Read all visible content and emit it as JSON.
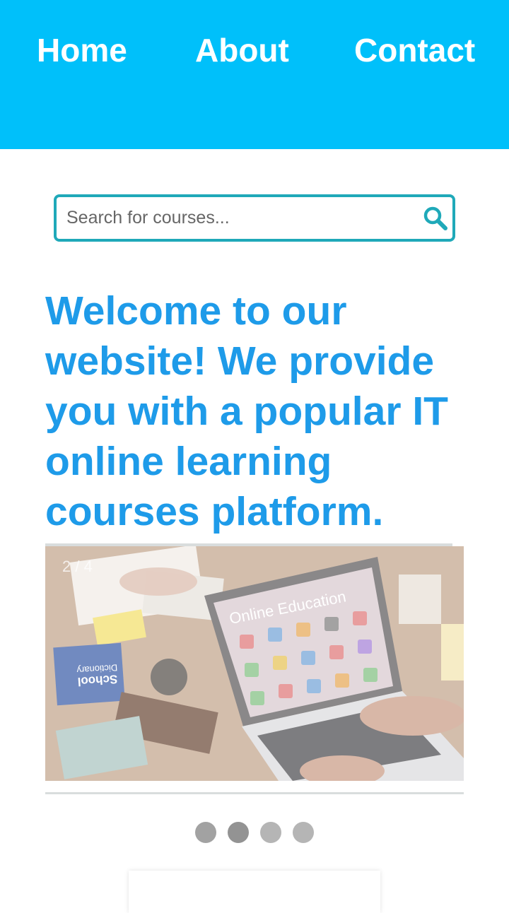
{
  "nav": {
    "home": "Home",
    "about": "About",
    "contact": "Contact",
    "background": "#00c0fa"
  },
  "search": {
    "placeholder": "Search for courses...",
    "value": "",
    "border_color": "#1fa9b9",
    "icon": "search-icon"
  },
  "hero": {
    "headline": "Welcome to our website! We provide you with a popular IT online learning courses platform.",
    "color": "#1e9be9"
  },
  "slider": {
    "counter": "2 / 4",
    "current": 2,
    "total": 4,
    "image": {
      "screen_title": "Online Education",
      "book_title": "School",
      "book_subtitle": "Dictionary"
    }
  }
}
